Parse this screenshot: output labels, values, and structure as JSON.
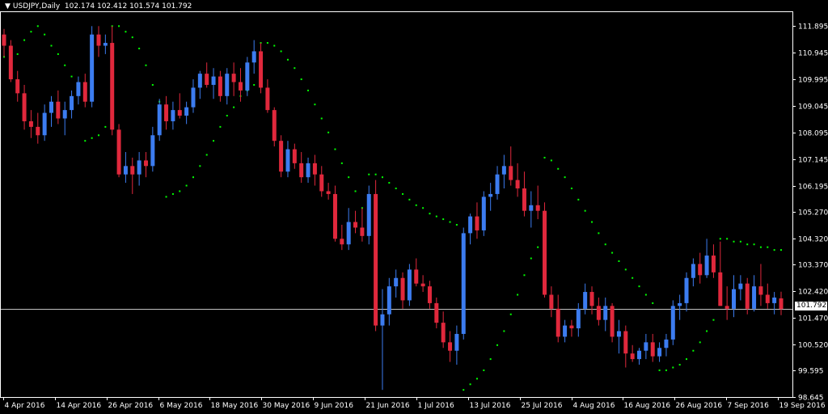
{
  "header": {
    "symbol_label": "USDJPY,Daily",
    "ohlc": "102.174 102.412 101.574 101.792",
    "arrow": "▼"
  },
  "colors": {
    "background": "#000000",
    "bull_candle": "#3c7cf0",
    "bear_candle": "#e0283c",
    "sar_dots": "#00ff00",
    "axis": "#ffffff",
    "price_line": "#c0c0c0"
  },
  "current_price": "101.792",
  "chart_data": {
    "type": "candlestick",
    "symbol": "USDJPY",
    "timeframe": "Daily",
    "ylim": [
      98.645,
      112.4
    ],
    "y_ticks": [
      "111.895",
      "110.945",
      "109.995",
      "109.045",
      "108.095",
      "107.145",
      "106.195",
      "105.270",
      "104.320",
      "103.370",
      "102.420",
      "101.470",
      "100.520",
      "99.595",
      "98.645"
    ],
    "x_ticks": [
      "4 Apr 2016",
      "14 Apr 2016",
      "26 Apr 2016",
      "6 May 2016",
      "18 May 2016",
      "30 May 2016",
      "9 Jun 2016",
      "21 Jun 2016",
      "1 Jul 2016",
      "13 Jul 2016",
      "25 Jul 2016",
      "4 Aug 2016",
      "16 Aug 2016",
      "26 Aug 2016",
      "7 Sep 2016",
      "19 Sep 2016"
    ],
    "current_price_line": 101.792,
    "candles": [
      [
        111.6,
        111.8,
        110.8,
        111.2
      ],
      [
        111.2,
        111.4,
        109.9,
        110.0
      ],
      [
        110.0,
        110.3,
        109.2,
        109.5
      ],
      [
        109.5,
        109.8,
        108.2,
        108.5
      ],
      [
        108.5,
        108.9,
        107.9,
        108.3
      ],
      [
        108.3,
        108.8,
        107.7,
        108.0
      ],
      [
        108.0,
        109.1,
        107.8,
        108.8
      ],
      [
        108.8,
        109.4,
        108.3,
        109.2
      ],
      [
        109.2,
        109.6,
        108.4,
        108.6
      ],
      [
        108.6,
        109.2,
        108.0,
        108.9
      ],
      [
        108.9,
        109.6,
        108.6,
        109.4
      ],
      [
        109.4,
        110.1,
        109.1,
        109.9
      ],
      [
        109.9,
        110.2,
        109.0,
        109.2
      ],
      [
        109.2,
        111.9,
        109.0,
        111.6
      ],
      [
        111.6,
        111.9,
        110.8,
        111.2
      ],
      [
        111.2,
        111.6,
        110.9,
        111.3
      ],
      [
        111.3,
        111.9,
        108.0,
        108.2
      ],
      [
        108.2,
        108.4,
        106.5,
        106.6
      ],
      [
        106.6,
        107.4,
        106.3,
        106.9
      ],
      [
        106.9,
        107.2,
        105.9,
        106.6
      ],
      [
        106.6,
        107.4,
        106.2,
        107.1
      ],
      [
        107.1,
        107.4,
        106.5,
        106.9
      ],
      [
        106.9,
        108.3,
        106.7,
        108.0
      ],
      [
        108.0,
        109.3,
        107.8,
        109.1
      ],
      [
        109.1,
        109.4,
        108.2,
        108.5
      ],
      [
        108.5,
        109.2,
        108.2,
        108.9
      ],
      [
        108.9,
        109.5,
        108.6,
        108.7
      ],
      [
        108.7,
        109.2,
        108.4,
        109.0
      ],
      [
        109.0,
        110.0,
        108.8,
        109.7
      ],
      [
        109.7,
        110.3,
        109.3,
        110.2
      ],
      [
        110.2,
        110.6,
        109.7,
        109.8
      ],
      [
        109.8,
        110.4,
        109.3,
        110.1
      ],
      [
        110.1,
        110.3,
        109.2,
        109.4
      ],
      [
        109.4,
        110.4,
        109.1,
        110.2
      ],
      [
        110.2,
        110.6,
        109.4,
        109.9
      ],
      [
        109.9,
        110.4,
        109.2,
        109.6
      ],
      [
        109.6,
        110.8,
        109.4,
        110.6
      ],
      [
        110.6,
        111.4,
        110.2,
        111.0
      ],
      [
        111.0,
        111.3,
        109.5,
        109.7
      ],
      [
        109.7,
        110.0,
        108.8,
        108.9
      ],
      [
        108.9,
        109.0,
        107.6,
        107.8
      ],
      [
        107.8,
        108.0,
        106.5,
        106.7
      ],
      [
        106.7,
        107.8,
        106.5,
        107.5
      ],
      [
        107.5,
        107.7,
        106.8,
        107.0
      ],
      [
        107.0,
        107.4,
        106.3,
        106.5
      ],
      [
        106.5,
        107.2,
        106.3,
        107.0
      ],
      [
        107.0,
        107.3,
        106.2,
        106.6
      ],
      [
        106.6,
        106.9,
        105.8,
        106.0
      ],
      [
        106.0,
        106.3,
        105.7,
        105.9
      ],
      [
        105.9,
        106.2,
        104.2,
        104.3
      ],
      [
        104.3,
        104.8,
        103.9,
        104.1
      ],
      [
        104.1,
        105.4,
        103.9,
        104.9
      ],
      [
        104.9,
        105.3,
        104.5,
        104.7
      ],
      [
        104.7,
        105.4,
        104.2,
        104.4
      ],
      [
        104.4,
        106.2,
        104.1,
        105.9
      ],
      [
        105.9,
        106.4,
        101.0,
        101.2
      ],
      [
        101.2,
        102.5,
        98.9,
        101.6
      ],
      [
        101.6,
        102.9,
        101.2,
        102.6
      ],
      [
        102.6,
        103.2,
        102.2,
        102.9
      ],
      [
        102.9,
        103.1,
        101.8,
        102.1
      ],
      [
        102.1,
        103.4,
        101.9,
        103.2
      ],
      [
        103.2,
        103.6,
        102.6,
        102.7
      ],
      [
        102.7,
        103.0,
        102.4,
        102.6
      ],
      [
        102.6,
        102.8,
        101.8,
        102.0
      ],
      [
        102.0,
        102.2,
        101.1,
        101.3
      ],
      [
        101.3,
        101.7,
        100.4,
        100.6
      ],
      [
        100.6,
        101.0,
        99.9,
        100.3
      ],
      [
        100.3,
        101.2,
        99.8,
        100.9
      ],
      [
        100.9,
        104.7,
        100.7,
        104.5
      ],
      [
        104.5,
        105.2,
        104.1,
        105.1
      ],
      [
        105.1,
        105.6,
        104.3,
        104.6
      ],
      [
        104.6,
        106.0,
        104.4,
        105.8
      ],
      [
        105.8,
        106.3,
        105.3,
        105.9
      ],
      [
        105.9,
        106.9,
        105.7,
        106.6
      ],
      [
        106.6,
        107.3,
        106.1,
        106.9
      ],
      [
        106.9,
        107.6,
        106.2,
        106.4
      ],
      [
        106.4,
        107.0,
        105.8,
        106.1
      ],
      [
        106.1,
        106.7,
        105.1,
        105.3
      ],
      [
        105.3,
        106.0,
        104.7,
        105.5
      ],
      [
        105.5,
        106.2,
        105.0,
        105.3
      ],
      [
        105.3,
        105.6,
        102.2,
        102.3
      ],
      [
        102.3,
        102.6,
        101.5,
        101.8
      ],
      [
        101.8,
        102.3,
        100.6,
        100.8
      ],
      [
        100.8,
        101.4,
        100.6,
        101.2
      ],
      [
        101.2,
        101.4,
        100.8,
        101.1
      ],
      [
        101.1,
        102.0,
        100.8,
        101.8
      ],
      [
        101.8,
        102.7,
        101.6,
        102.4
      ],
      [
        102.4,
        102.6,
        101.6,
        101.9
      ],
      [
        101.9,
        102.2,
        101.2,
        101.4
      ],
      [
        101.4,
        102.2,
        101.0,
        101.9
      ],
      [
        101.9,
        102.0,
        100.6,
        100.8
      ],
      [
        100.8,
        101.4,
        100.2,
        101.0
      ],
      [
        101.0,
        101.2,
        99.7,
        100.2
      ],
      [
        100.2,
        100.5,
        99.9,
        100.0
      ],
      [
        100.0,
        100.4,
        99.8,
        100.3
      ],
      [
        100.3,
        100.9,
        100.0,
        100.6
      ],
      [
        100.6,
        100.9,
        99.9,
        100.1
      ],
      [
        100.1,
        100.6,
        99.9,
        100.4
      ],
      [
        100.4,
        100.9,
        100.1,
        100.7
      ],
      [
        100.7,
        102.1,
        100.5,
        101.9
      ],
      [
        101.9,
        102.3,
        101.4,
        102.0
      ],
      [
        102.0,
        103.1,
        101.7,
        102.9
      ],
      [
        102.9,
        103.6,
        102.6,
        103.4
      ],
      [
        103.4,
        103.8,
        102.7,
        103.0
      ],
      [
        103.0,
        104.3,
        102.9,
        103.7
      ],
      [
        103.7,
        104.1,
        102.9,
        103.1
      ],
      [
        103.1,
        104.2,
        101.9,
        101.9
      ],
      [
        101.9,
        102.6,
        101.4,
        101.8
      ],
      [
        101.8,
        103.0,
        101.5,
        102.5
      ],
      [
        102.5,
        103.0,
        102.1,
        102.7
      ],
      [
        102.7,
        102.9,
        101.6,
        101.8
      ],
      [
        101.8,
        103.0,
        101.7,
        102.6
      ],
      [
        102.6,
        103.4,
        101.9,
        102.3
      ],
      [
        102.3,
        102.7,
        101.8,
        102.0
      ],
      [
        102.0,
        102.4,
        101.6,
        102.2
      ],
      [
        102.17,
        102.41,
        101.57,
        101.79
      ]
    ],
    "parabolic_sar": [
      [
        0,
        110.8
      ],
      [
        1,
        110.6
      ],
      [
        2,
        110.9
      ],
      [
        3,
        111.4
      ],
      [
        4,
        111.7
      ],
      [
        5,
        111.9
      ],
      [
        6,
        111.6
      ],
      [
        7,
        111.2
      ],
      [
        8,
        110.9
      ],
      [
        9,
        110.5
      ],
      [
        10,
        110.1
      ],
      [
        11,
        109.6
      ],
      [
        12,
        107.8
      ],
      [
        13,
        107.9
      ],
      [
        14,
        108.0
      ],
      [
        15,
        108.3
      ],
      [
        16,
        111.9
      ],
      [
        17,
        111.9
      ],
      [
        18,
        111.7
      ],
      [
        19,
        111.5
      ],
      [
        20,
        111.1
      ],
      [
        21,
        110.5
      ],
      [
        22,
        109.8
      ],
      [
        23,
        109.2
      ],
      [
        24,
        105.8
      ],
      [
        25,
        105.9
      ],
      [
        26,
        106.0
      ],
      [
        27,
        106.2
      ],
      [
        28,
        106.5
      ],
      [
        29,
        106.9
      ],
      [
        30,
        107.3
      ],
      [
        31,
        107.8
      ],
      [
        32,
        108.3
      ],
      [
        33,
        108.7
      ],
      [
        34,
        109.0
      ],
      [
        35,
        109.4
      ],
      [
        36,
        109.6
      ],
      [
        37,
        109.8
      ],
      [
        38,
        111.3
      ],
      [
        39,
        111.3
      ],
      [
        40,
        111.2
      ],
      [
        41,
        111.0
      ],
      [
        42,
        110.7
      ],
      [
        43,
        110.4
      ],
      [
        44,
        110.0
      ],
      [
        45,
        109.6
      ],
      [
        46,
        109.1
      ],
      [
        47,
        108.6
      ],
      [
        48,
        108.1
      ],
      [
        49,
        107.5
      ],
      [
        50,
        107.0
      ],
      [
        51,
        106.5
      ],
      [
        52,
        106.0
      ],
      [
        53,
        105.4
      ],
      [
        54,
        106.6
      ],
      [
        55,
        106.6
      ],
      [
        56,
        106.5
      ],
      [
        57,
        106.3
      ],
      [
        58,
        106.1
      ],
      [
        59,
        105.9
      ],
      [
        60,
        105.7
      ],
      [
        61,
        105.5
      ],
      [
        62,
        105.4
      ],
      [
        63,
        105.2
      ],
      [
        64,
        105.1
      ],
      [
        65,
        105.0
      ],
      [
        66,
        104.9
      ],
      [
        67,
        104.8
      ],
      [
        68,
        98.9
      ],
      [
        69,
        99.1
      ],
      [
        70,
        99.3
      ],
      [
        71,
        99.6
      ],
      [
        72,
        100.0
      ],
      [
        73,
        100.5
      ],
      [
        74,
        101.0
      ],
      [
        75,
        101.6
      ],
      [
        76,
        102.3
      ],
      [
        77,
        103.0
      ],
      [
        78,
        103.6
      ],
      [
        79,
        104.0
      ],
      [
        80,
        107.2
      ],
      [
        81,
        107.1
      ],
      [
        82,
        106.8
      ],
      [
        83,
        106.5
      ],
      [
        84,
        106.1
      ],
      [
        85,
        105.7
      ],
      [
        86,
        105.3
      ],
      [
        87,
        104.9
      ],
      [
        88,
        104.5
      ],
      [
        89,
        104.1
      ],
      [
        90,
        103.8
      ],
      [
        91,
        103.5
      ],
      [
        92,
        103.2
      ],
      [
        93,
        102.9
      ],
      [
        94,
        102.6
      ],
      [
        95,
        102.3
      ],
      [
        96,
        102.0
      ],
      [
        97,
        99.6
      ],
      [
        98,
        99.6
      ],
      [
        99,
        99.7
      ],
      [
        100,
        99.8
      ],
      [
        101,
        100.0
      ],
      [
        102,
        100.3
      ],
      [
        103,
        100.6
      ],
      [
        104,
        101.0
      ],
      [
        105,
        101.4
      ],
      [
        106,
        104.3
      ],
      [
        107,
        104.3
      ],
      [
        108,
        104.2
      ],
      [
        109,
        104.2
      ],
      [
        110,
        104.1
      ],
      [
        111,
        104.1
      ],
      [
        112,
        104.0
      ],
      [
        113,
        104.0
      ],
      [
        114,
        103.9
      ],
      [
        115,
        103.9
      ]
    ]
  }
}
